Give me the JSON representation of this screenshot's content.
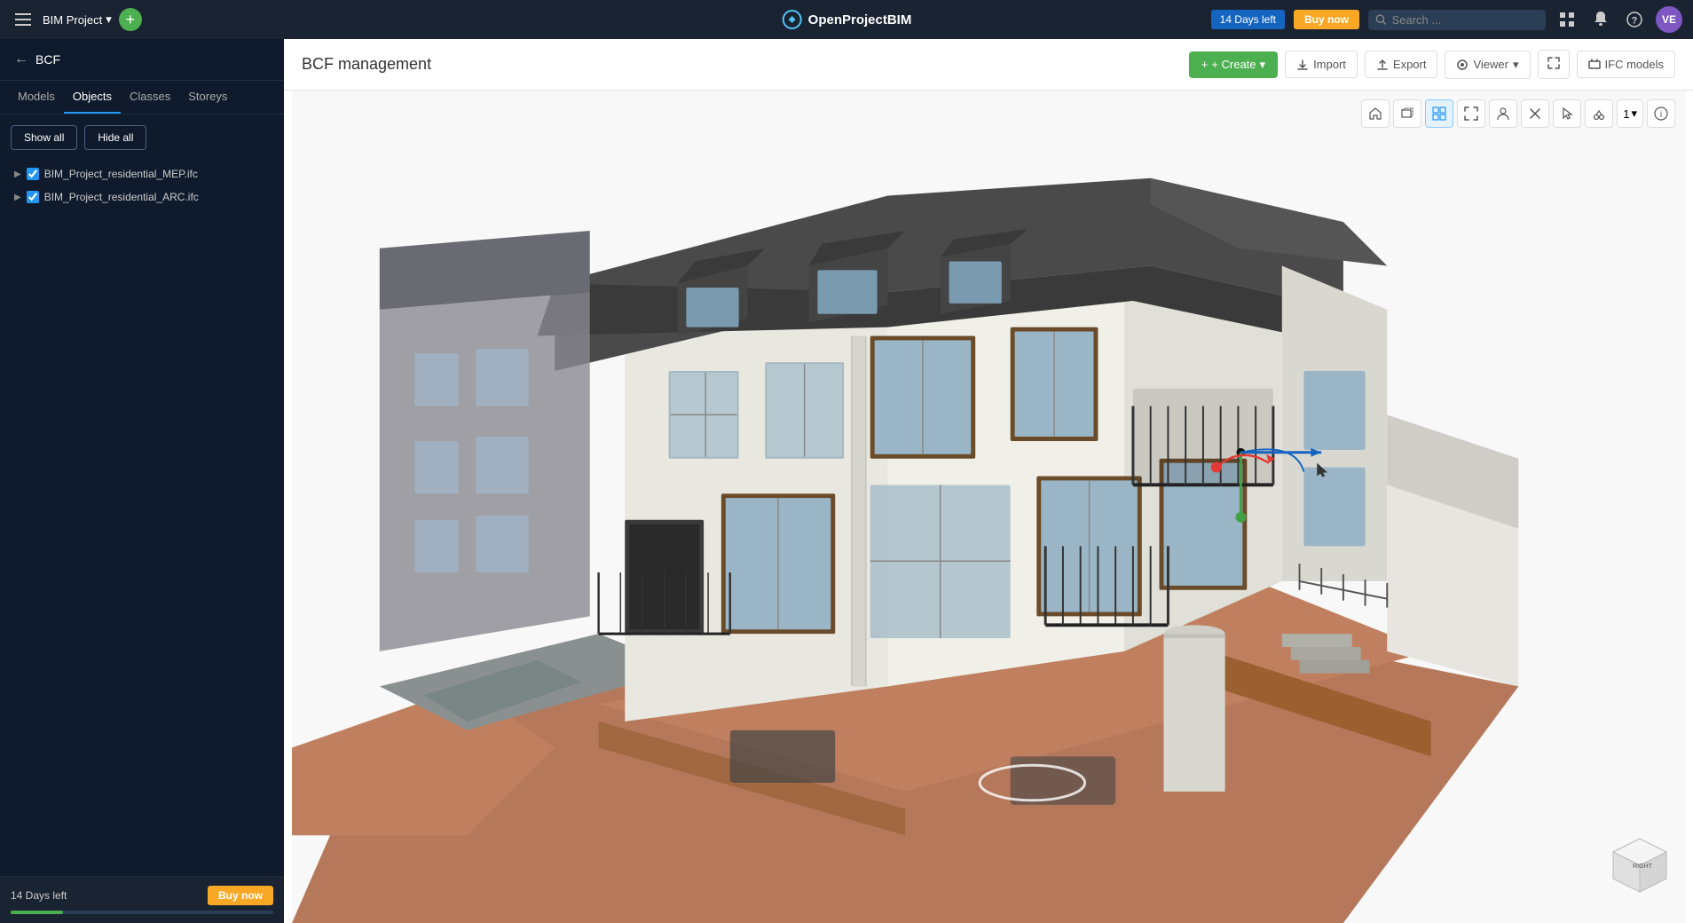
{
  "navbar": {
    "menu_icon": "☰",
    "project_name": "BIM Project",
    "project_dropdown": "▾",
    "add_icon": "+",
    "logo_text": "OpenProjectBIM",
    "trial_text": "14 Days left",
    "buy_now": "Buy now",
    "search_placeholder": "Search ...",
    "search_icon": "🔍",
    "grid_icon": "⊞",
    "bell_icon": "🔔",
    "help_icon": "?",
    "avatar_text": "VE"
  },
  "sidebar": {
    "back_icon": "←",
    "section_title": "BCF",
    "tabs": [
      {
        "label": "Models",
        "active": false
      },
      {
        "label": "Objects",
        "active": true
      },
      {
        "label": "Classes",
        "active": false
      },
      {
        "label": "Storeys",
        "active": false
      }
    ],
    "show_all": "Show all",
    "hide_all": "Hide all",
    "models": [
      {
        "label": "BIM_Project_residential_MEP.ifc",
        "checked": true
      },
      {
        "label": "BIM_Project_residential_ARC.ifc",
        "checked": true
      }
    ],
    "footer": {
      "trial_text": "14 Days left",
      "buy_btn": "Buy now"
    }
  },
  "main": {
    "title": "BCF management",
    "create_btn": "+ Create",
    "import_btn": "Import",
    "export_btn": "Export",
    "viewer_btn": "Viewer",
    "expand_btn": "⤢",
    "ifc_models_btn": "IFC models"
  },
  "toolbar": {
    "home": "⌂",
    "cube": "◻",
    "grid": "⊞",
    "fit": "⤡",
    "person": "👤",
    "eraser": "✕",
    "cursor": "↖",
    "scissors": "✂",
    "level_label": "1",
    "info": "ℹ"
  },
  "nav_cube": {
    "label": "RIGHT"
  }
}
